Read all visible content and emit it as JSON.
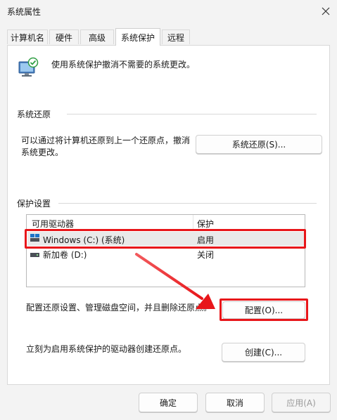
{
  "window": {
    "title": "系统属性"
  },
  "tabs": [
    {
      "label": "计算机名"
    },
    {
      "label": "硬件"
    },
    {
      "label": "高级"
    },
    {
      "label": "系统保护"
    },
    {
      "label": "远程"
    }
  ],
  "intro": {
    "text": "使用系统保护撤消不需要的系统更改。"
  },
  "restore": {
    "group_title": "系统还原",
    "description_line1": "可以通过将计算机还原到上一个还原点，撤消",
    "description_line2": "系统更改。",
    "button_label": "系统还原(S)..."
  },
  "protection": {
    "group_title": "保护设置",
    "columns": [
      "可用驱动器",
      "保护"
    ],
    "drives": [
      {
        "name": "Windows (C:) (系统)",
        "status": "启用"
      },
      {
        "name": "新加卷 (D:)",
        "status": "关闭"
      }
    ],
    "configure_text": "配置还原设置、管理磁盘空间，并且删除还原点。",
    "configure_button": "配置(O)...",
    "create_text": "立刻为启用系统保护的驱动器创建还原点。",
    "create_button": "创建(C)..."
  },
  "footer": {
    "ok": "确定",
    "cancel": "取消",
    "apply": "应用(A)"
  },
  "colors": {
    "highlight": "#e8161a",
    "selected_row": "#e9e9e9"
  }
}
